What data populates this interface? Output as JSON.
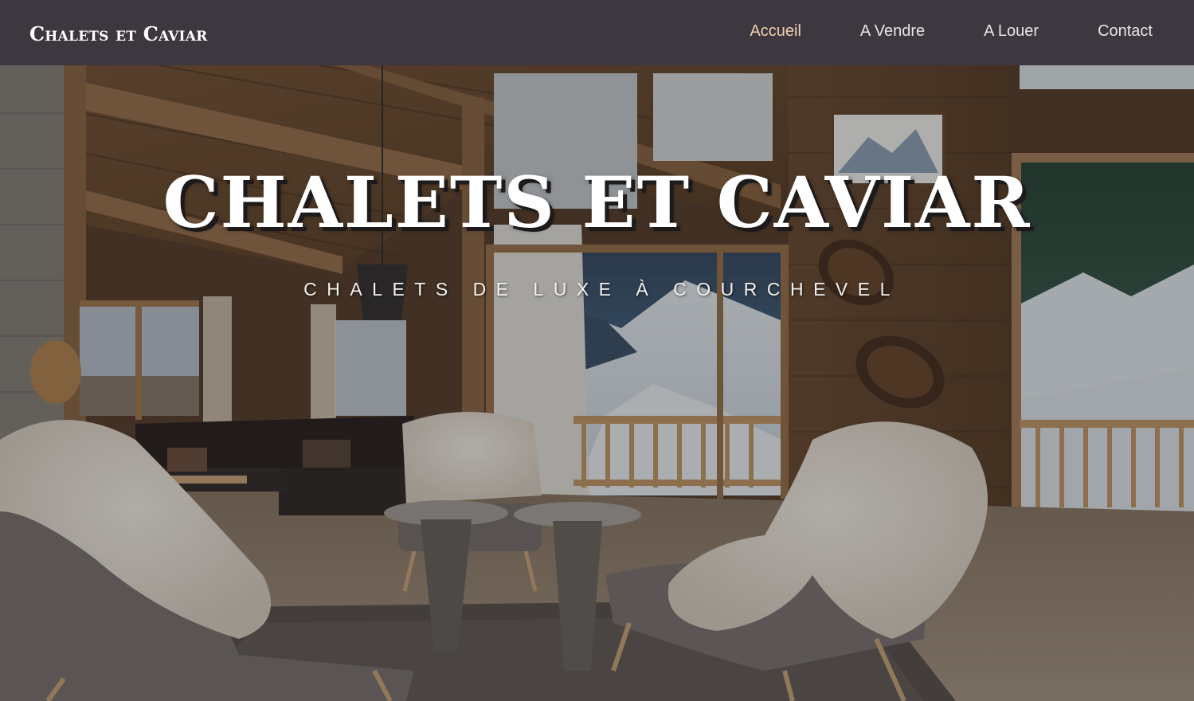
{
  "header": {
    "brand": "Chalets et Caviar",
    "nav": [
      {
        "label": "Accueil",
        "active": true
      },
      {
        "label": "A Vendre",
        "active": false
      },
      {
        "label": "A Louer",
        "active": false
      },
      {
        "label": "Contact",
        "active": false
      }
    ]
  },
  "hero": {
    "title": "CHALETS ET CAVIAR",
    "subtitle": "CHALETS DE LUXE À COURCHEVEL",
    "background": "chalet living room photo"
  },
  "colors": {
    "navbar": "#3d3840",
    "nav_active": "#f3cfae",
    "nav_text": "#e9e4e8"
  }
}
